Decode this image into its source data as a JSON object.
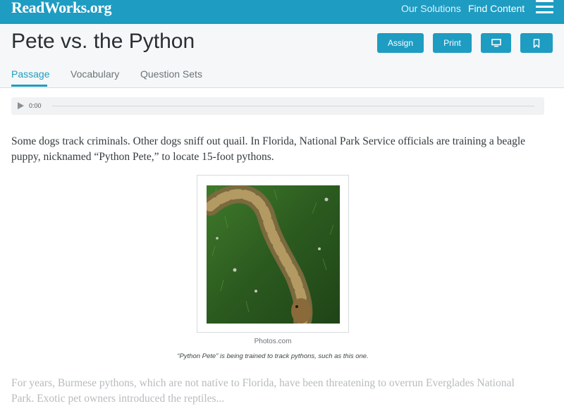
{
  "brand": {
    "logo_text": "ReadWorks.org"
  },
  "top_nav": {
    "our_solutions": "Our Solutions",
    "find_content": "Find Content"
  },
  "page": {
    "title": "Pete vs. the Python",
    "buttons": {
      "assign": "Assign",
      "print": "Print"
    },
    "tabs": [
      "Passage",
      "Vocabulary",
      "Question Sets"
    ],
    "active_tab": "Passage"
  },
  "audio": {
    "time": "0:00",
    "progress": 0
  },
  "passage": {
    "paragraph_1": "Some dogs track criminals. Other dogs sniff out quail. In Florida, National Park Service officials are training a beagle puppy, nicknamed “Python Pete,” to locate 15-foot pythons.",
    "image": {
      "credit": "Photos.com",
      "caption": "“Python Pete” is being trained to track pythons, such as this one."
    },
    "paragraph_2": "For years, Burmese pythons, which are not native to Florida, have been threatening to overrun Everglades National Park. Exotic pet owners introduced the reptiles..."
  },
  "colors": {
    "brand_blue": "#1e9cc2",
    "header_bg": "#f6f7f8",
    "text": "#333a3e"
  },
  "icons": {
    "menu": "hamburger-icon",
    "present": "monitor-icon",
    "save": "bookmark-icon",
    "play": "play-icon"
  }
}
